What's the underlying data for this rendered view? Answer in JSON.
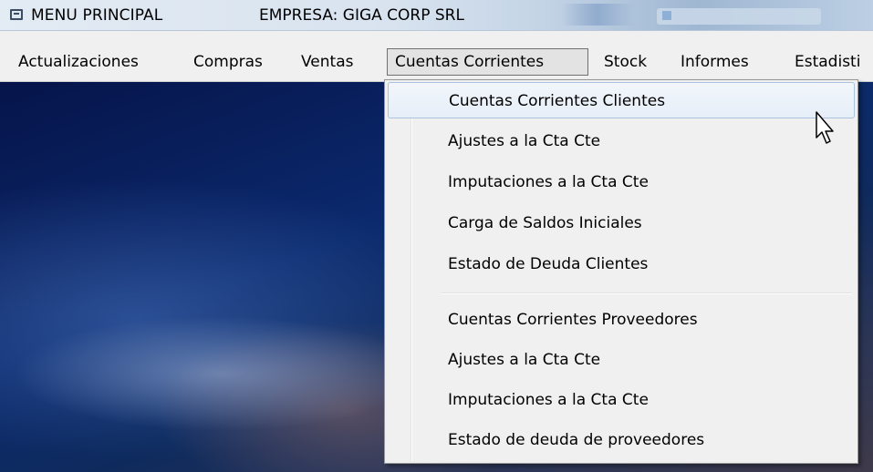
{
  "window": {
    "title": "MENU PRINCIPAL",
    "company": "EMPRESA: GIGA CORP SRL"
  },
  "menubar": {
    "items": [
      {
        "label": "Actualizaciones"
      },
      {
        "label": "Compras"
      },
      {
        "label": "Ventas"
      },
      {
        "label": "Cuentas Corrientes",
        "active": true
      },
      {
        "label": "Stock"
      },
      {
        "label": "Informes"
      },
      {
        "label": "Estadisti"
      }
    ]
  },
  "dropdown": {
    "clientes": [
      {
        "label": "Cuentas Corrientes Clientes",
        "highlighted": true
      },
      {
        "label": "Ajustes a la Cta Cte"
      },
      {
        "label": "Imputaciones a la Cta Cte"
      },
      {
        "label": "Carga de Saldos Iniciales"
      },
      {
        "label": "Estado de Deuda Clientes"
      }
    ],
    "proveedores": [
      {
        "label": "Cuentas Corrientes Proveedores"
      },
      {
        "label": "Ajustes a la Cta Cte"
      },
      {
        "label": "Imputaciones a la Cta Cte"
      },
      {
        "label": "Estado de deuda de proveedores"
      }
    ]
  },
  "icons": {
    "app": "window-app-icon",
    "cursor": "mouse-pointer-icon"
  },
  "colors": {
    "menu_background": "#f0f0f0",
    "highlight_border": "#a8c2e0",
    "desktop_top": "#06144a"
  }
}
